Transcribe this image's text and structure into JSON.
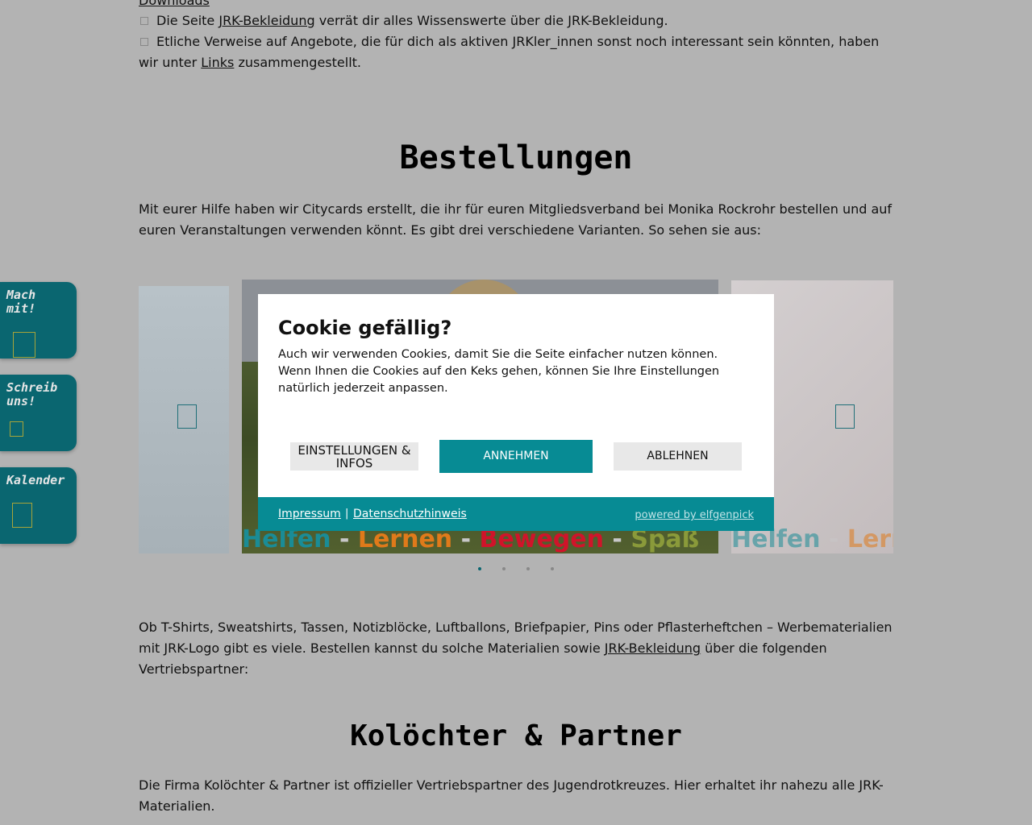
{
  "intro": {
    "top_link": "Downloads",
    "bullets": [
      {
        "pre": "Die Seite ",
        "link": "JRK-Bekleidung",
        "post": " verrät dir alles Wissenswerte über die JRK-Bekleidung."
      },
      {
        "pre": "Etliche Verweise auf Angebote, die für dich als aktiven JRKler_innen sonst noch interessant sein könnten, haben wir unter ",
        "link": "Links",
        "post": " zusammengestellt."
      }
    ]
  },
  "bestellungen": {
    "heading": "Bestellungen",
    "text": "Mit eurer Hilfe haben wir Citycards erstellt, die ihr für euren Mitgliedsverband bei Monika Rockrohr bestellen und auf euren Veranstaltungen verwenden könnt. Es gibt drei verschiedene Varianten. So sehen sie aus:"
  },
  "side_tabs": [
    {
      "label": "Mach mit!"
    },
    {
      "label": "Schreib uns!"
    },
    {
      "label": "Kalender"
    }
  ],
  "carousel": {
    "slogan_words": [
      {
        "text": "Helfen",
        "color": "#1a8c96"
      },
      {
        "text": " - ",
        "color": "#c8c8c8"
      },
      {
        "text": "Lernen",
        "color": "#e07a1a"
      },
      {
        "text": " - ",
        "color": "#c8c8c8"
      },
      {
        "text": "Bewegen",
        "color": "#d0142a"
      },
      {
        "text": " - ",
        "color": "#c8c8c8"
      },
      {
        "text": "Spaß",
        "color": "#8a9a3a"
      }
    ],
    "slide_count": 4,
    "active_slide": 1
  },
  "materials": {
    "text_pre": "Ob T-Shirts, Sweatshirts, Tassen, Notizblöcke, Luftballons, Briefpapier, Pins oder Pflasterheftchen – Werbematerialien mit JRK-Logo gibt es viele. Bestellen kannst du solche Materialien sowie ",
    "link": "JRK-Bekleidung",
    "text_post": " über die folgenden Vertriebspartner:"
  },
  "partner": {
    "heading": "Kolöchter & Partner",
    "text": "Die Firma Kolöchter & Partner ist offizieller Vertriebspartner des Jugendrotkreuzes. Hier erhaltet ihr nahezu alle JRK-Materialien."
  },
  "cookie": {
    "title": "Cookie gefällig?",
    "message": "Auch wir verwenden Cookies, damit Sie die Seite einfacher nutzen können. Wenn Ihnen die Cookies auf den Keks gehen, können Sie Ihre Einstellungen natürlich jederzeit anpassen.",
    "settings_label": "Einstellungen & Infos",
    "accept_label": "Annehmen",
    "reject_label": "Ablehnen",
    "impressum": "Impressum",
    "separator": "|",
    "datenschutz": "Datenschutzhinweis",
    "powered": "powered by elfgenpick"
  },
  "colors": {
    "teal": "#078b94",
    "side_tab": "#0a6670",
    "overlay_bg": "#b3b3b3"
  }
}
